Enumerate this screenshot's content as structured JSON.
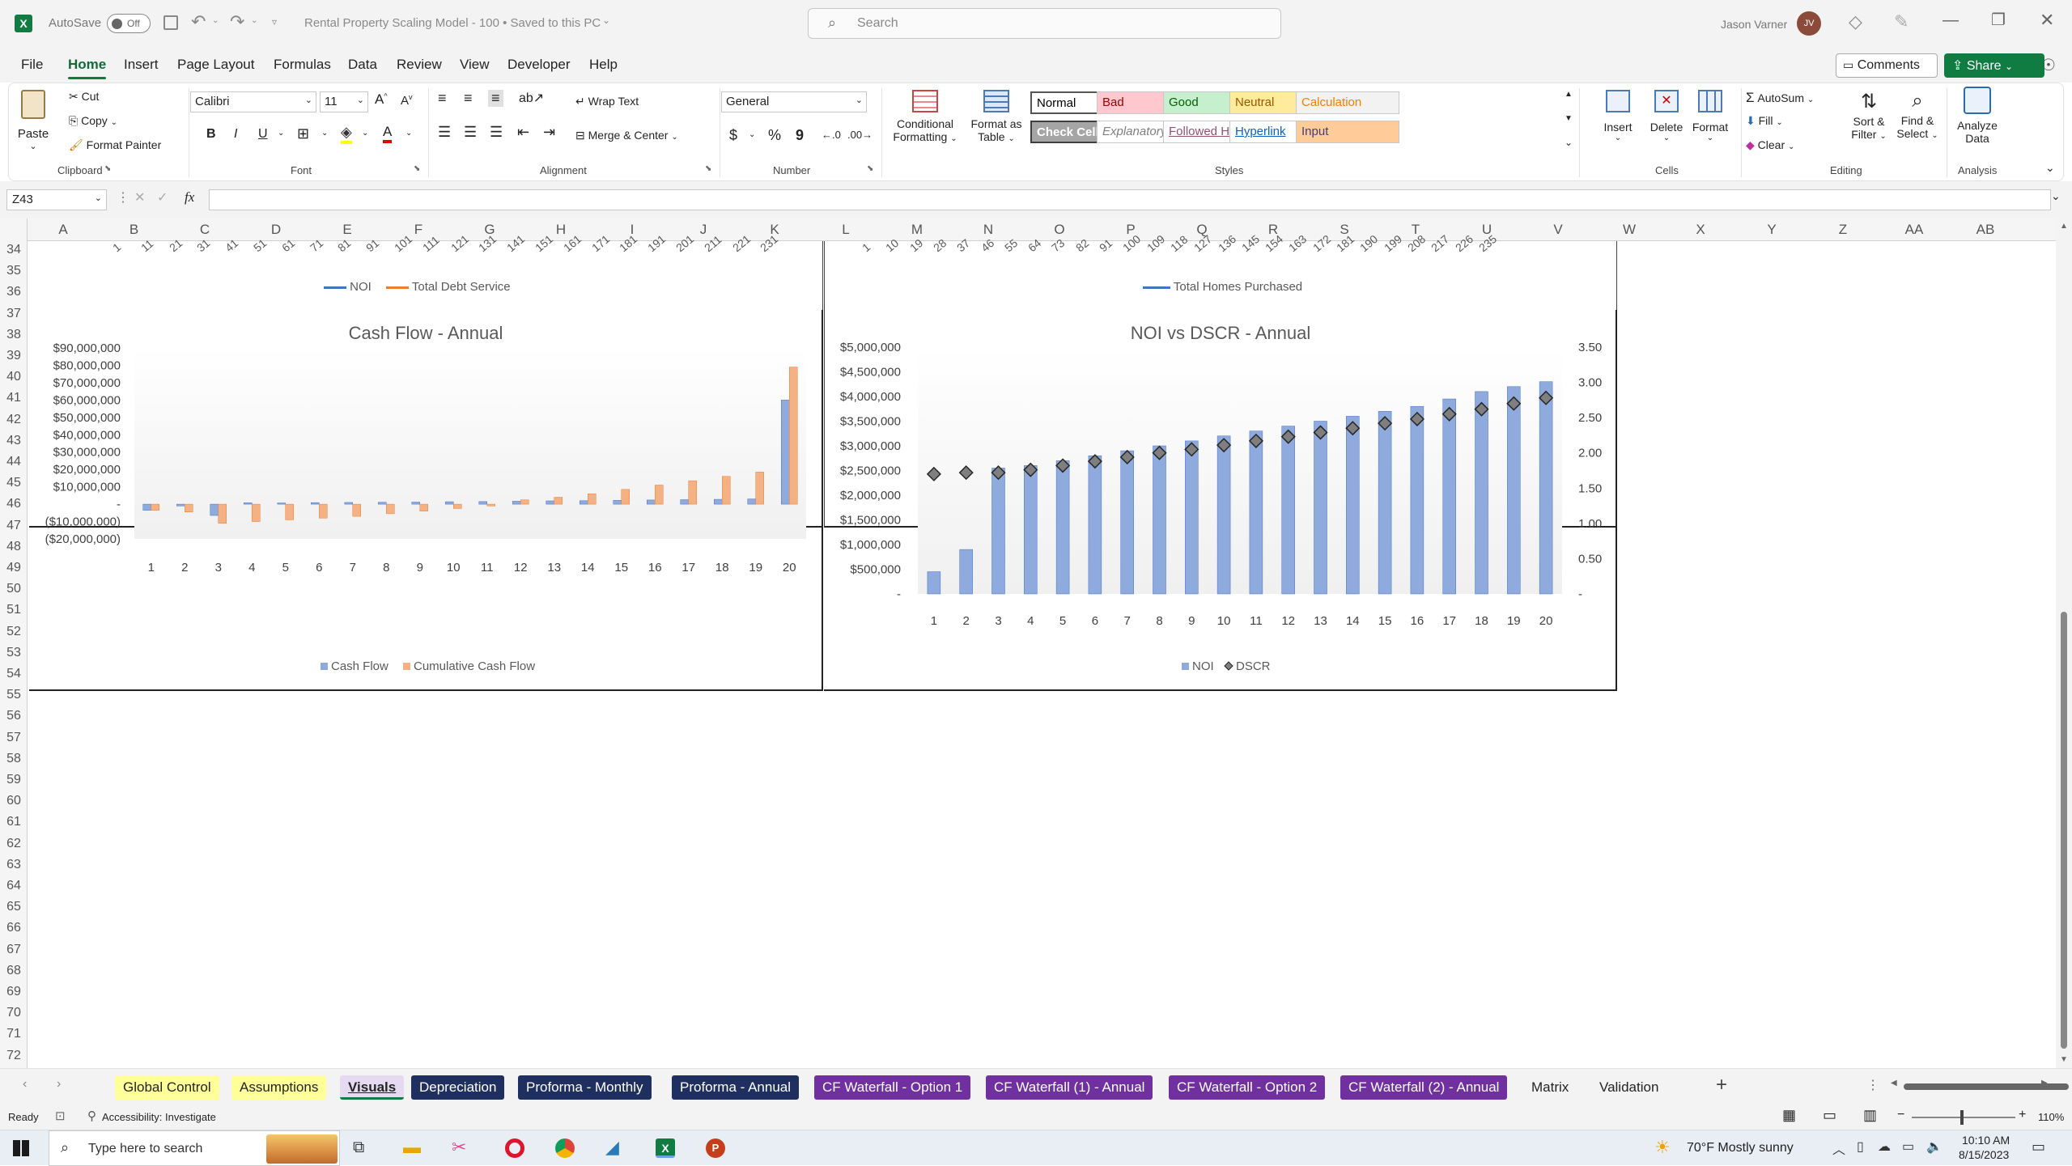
{
  "titlebar": {
    "autosave_label": "AutoSave",
    "autosave_state": "Off",
    "document_title": "Rental Property Scaling Model - 100 • Saved to this PC",
    "search_placeholder": "Search",
    "user_name": "Jason Varner",
    "user_initials": "JV"
  },
  "menu": {
    "items": [
      "File",
      "Home",
      "Insert",
      "Page Layout",
      "Formulas",
      "Data",
      "Review",
      "View",
      "Developer",
      "Help"
    ],
    "active": "Home",
    "comments_label": "Comments",
    "share_label": "Share"
  },
  "ribbon": {
    "clipboard": {
      "paste": "Paste",
      "cut": "Cut",
      "copy": "Copy",
      "format_painter": "Format Painter",
      "group": "Clipboard"
    },
    "font": {
      "name": "Calibri",
      "size": "11",
      "group": "Font",
      "bold": "B",
      "italic": "I",
      "underline": "U"
    },
    "alignment": {
      "wrap": "Wrap Text",
      "merge": "Merge & Center",
      "group": "Alignment"
    },
    "number": {
      "format": "General",
      "group": "Number",
      "currency": "$",
      "percent": "%",
      "comma": "9"
    },
    "styles": {
      "conditional": "Conditional",
      "conditional2": "Formatting",
      "format_as": "Format as",
      "format_as2": "Table",
      "group": "Styles",
      "cells": [
        {
          "label": "Normal",
          "bg": "#ffffff",
          "fg": "#000000"
        },
        {
          "label": "Bad",
          "bg": "#ffc7ce",
          "fg": "#9c0006"
        },
        {
          "label": "Good",
          "bg": "#c6efce",
          "fg": "#006100"
        },
        {
          "label": "Neutral",
          "bg": "#ffeb9c",
          "fg": "#9c5700"
        },
        {
          "label": "Calculation",
          "bg": "#f2f2f2",
          "fg": "#fa7d00"
        },
        {
          "label": "Check Cell",
          "bg": "#a5a5a5",
          "fg": "#ffffff"
        },
        {
          "label": "Explanatory T...",
          "bg": "#ffffff",
          "fg": "#7f7f7f"
        },
        {
          "label": "Followed Hyp...",
          "bg": "#ffffff",
          "fg": "#954f72"
        },
        {
          "label": "Hyperlink",
          "bg": "#ffffff",
          "fg": "#0563c1"
        },
        {
          "label": "Input",
          "bg": "#ffcc99",
          "fg": "#3f3f76"
        }
      ]
    },
    "cells": {
      "insert": "Insert",
      "delete": "Delete",
      "format": "Format",
      "group": "Cells"
    },
    "editing": {
      "autosum": "AutoSum",
      "fill": "Fill",
      "clear": "Clear",
      "sort": "Sort &",
      "sort2": "Filter",
      "find": "Find &",
      "find2": "Select",
      "group": "Editing"
    },
    "analysis": {
      "analyze": "Analyze",
      "analyze2": "Data",
      "group": "Analysis"
    }
  },
  "formula_bar": {
    "name_box": "Z43",
    "fx": "fx",
    "value": ""
  },
  "columns": [
    "A",
    "B",
    "C",
    "D",
    "E",
    "F",
    "G",
    "H",
    "I",
    "J",
    "K",
    "L",
    "M",
    "N",
    "O",
    "P",
    "Q",
    "R",
    "S",
    "T",
    "U",
    "V",
    "W",
    "X",
    "Y",
    "Z",
    "AA",
    "AB"
  ],
  "rows": [
    "34",
    "35",
    "36",
    "37",
    "38",
    "39",
    "40",
    "41",
    "42",
    "43",
    "44",
    "45",
    "46",
    "47",
    "48",
    "49",
    "50",
    "51",
    "52",
    "53",
    "54",
    "55",
    "56",
    "57",
    "58",
    "59",
    "60",
    "61",
    "62",
    "63",
    "64",
    "65",
    "66",
    "67",
    "68",
    "69",
    "70",
    "71",
    "72"
  ],
  "top_charts": {
    "left_ticks": [
      "1",
      "11",
      "21",
      "31",
      "41",
      "51",
      "61",
      "71",
      "81",
      "91",
      "101",
      "111",
      "121",
      "131",
      "141",
      "151",
      "161",
      "171",
      "181",
      "191",
      "201",
      "211",
      "221",
      "231"
    ],
    "left_legend": [
      "NOI",
      "Total Debt Service"
    ],
    "right_ticks": [
      "1",
      "10",
      "19",
      "28",
      "37",
      "46",
      "55",
      "64",
      "73",
      "82",
      "91",
      "100",
      "109",
      "118",
      "127",
      "136",
      "145",
      "154",
      "163",
      "172",
      "181",
      "190",
      "199",
      "208",
      "217",
      "226",
      "235"
    ],
    "right_legend": [
      "Total Homes Purchased"
    ]
  },
  "chart_data": [
    {
      "type": "bar",
      "title": "Cash Flow - Annual",
      "categories": [
        "1",
        "2",
        "3",
        "4",
        "5",
        "6",
        "7",
        "8",
        "9",
        "10",
        "11",
        "12",
        "13",
        "14",
        "15",
        "16",
        "17",
        "18",
        "19",
        "20"
      ],
      "series": [
        {
          "name": "Cash Flow",
          "color": "#8faadc",
          "values": [
            -3500000,
            -1000000,
            -6500000,
            800000,
            700000,
            900000,
            1000000,
            1100000,
            1200000,
            1400000,
            1500000,
            1700000,
            1900000,
            2000000,
            2200000,
            2400000,
            2600000,
            2800000,
            3000000,
            60000000
          ]
        },
        {
          "name": "Cumulative Cash Flow",
          "color": "#f4b183",
          "values": [
            -3500000,
            -4500000,
            -11000000,
            -10000000,
            -9000000,
            -8000000,
            -7000000,
            -5500000,
            -4000000,
            -2500000,
            -1000000,
            2500000,
            4000000,
            6000000,
            8500000,
            11000000,
            13500000,
            16000000,
            18500000,
            79000000
          ]
        }
      ],
      "yticks": [
        "$90,000,000",
        "$80,000,000",
        "$70,000,000",
        "$60,000,000",
        "$50,000,000",
        "$40,000,000",
        "$30,000,000",
        "$20,000,000",
        "$10,000,000",
        "-",
        "($10,000,000)",
        "($20,000,000)"
      ],
      "ylim": [
        -20000000,
        90000000
      ]
    },
    {
      "type": "bar",
      "title": "NOI vs DSCR - Annual",
      "categories": [
        "1",
        "2",
        "3",
        "4",
        "5",
        "6",
        "7",
        "8",
        "9",
        "10",
        "11",
        "12",
        "13",
        "14",
        "15",
        "16",
        "17",
        "18",
        "19",
        "20"
      ],
      "series": [
        {
          "name": "NOI",
          "color": "#8faadc",
          "values": [
            450000,
            900000,
            2550000,
            2600000,
            2700000,
            2800000,
            2900000,
            3000000,
            3100000,
            3200000,
            3300000,
            3400000,
            3500000,
            3600000,
            3700000,
            3800000,
            3950000,
            4100000,
            4200000,
            4300000
          ]
        },
        {
          "name": "DSCR",
          "color": "#595959",
          "values": [
            1.7,
            1.72,
            1.72,
            1.76,
            1.82,
            1.88,
            1.94,
            2.0,
            2.05,
            2.11,
            2.17,
            2.23,
            2.29,
            2.35,
            2.42,
            2.48,
            2.55,
            2.62,
            2.7,
            2.78
          ]
        }
      ],
      "yticks": [
        "$5,000,000",
        "$4,500,000",
        "$4,000,000",
        "$3,500,000",
        "$3,000,000",
        "$2,500,000",
        "$2,000,000",
        "$1,500,000",
        "$1,000,000",
        "$500,000",
        "-"
      ],
      "ylim": [
        0,
        5000000
      ],
      "y2ticks": [
        "3.50",
        "3.00",
        "2.50",
        "2.00",
        "1.50",
        "1.00",
        "0.50",
        "-"
      ],
      "y2lim": [
        0,
        3.5
      ]
    }
  ],
  "sheet_tabs": [
    {
      "label": "Global Control",
      "bg": "#ffff99",
      "fg": "#242424"
    },
    {
      "label": "Assumptions",
      "bg": "#ffff99",
      "fg": "#242424"
    },
    {
      "label": "Visuals",
      "bg": "#e6d9f2",
      "fg": "#242424"
    },
    {
      "label": "Depreciation",
      "bg": "#1f2f5f",
      "fg": "#ffffff"
    },
    {
      "label": "Proforma - Monthly",
      "bg": "#1f2f5f",
      "fg": "#ffffff"
    },
    {
      "label": "Proforma - Annual",
      "bg": "#1f2f5f",
      "fg": "#ffffff"
    },
    {
      "label": "CF Waterfall - Option 1",
      "bg": "#7030a0",
      "fg": "#ffffff"
    },
    {
      "label": "CF Waterfall (1) - Annual",
      "bg": "#7030a0",
      "fg": "#ffffff"
    },
    {
      "label": "CF Waterfall - Option 2",
      "bg": "#7030a0",
      "fg": "#ffffff"
    },
    {
      "label": "CF Waterfall (2) - Annual",
      "bg": "#7030a0",
      "fg": "#ffffff"
    },
    {
      "label": "Matrix",
      "bg": "transparent",
      "fg": "#242424"
    },
    {
      "label": "Validation",
      "bg": "transparent",
      "fg": "#242424"
    }
  ],
  "status": {
    "ready": "Ready",
    "accessibility": "Accessibility: Investigate",
    "zoom": "110%"
  },
  "taskbar": {
    "search_placeholder": "Type here to search",
    "weather": "70°F  Mostly sunny",
    "time": "10:10 AM",
    "date": "8/15/2023"
  }
}
